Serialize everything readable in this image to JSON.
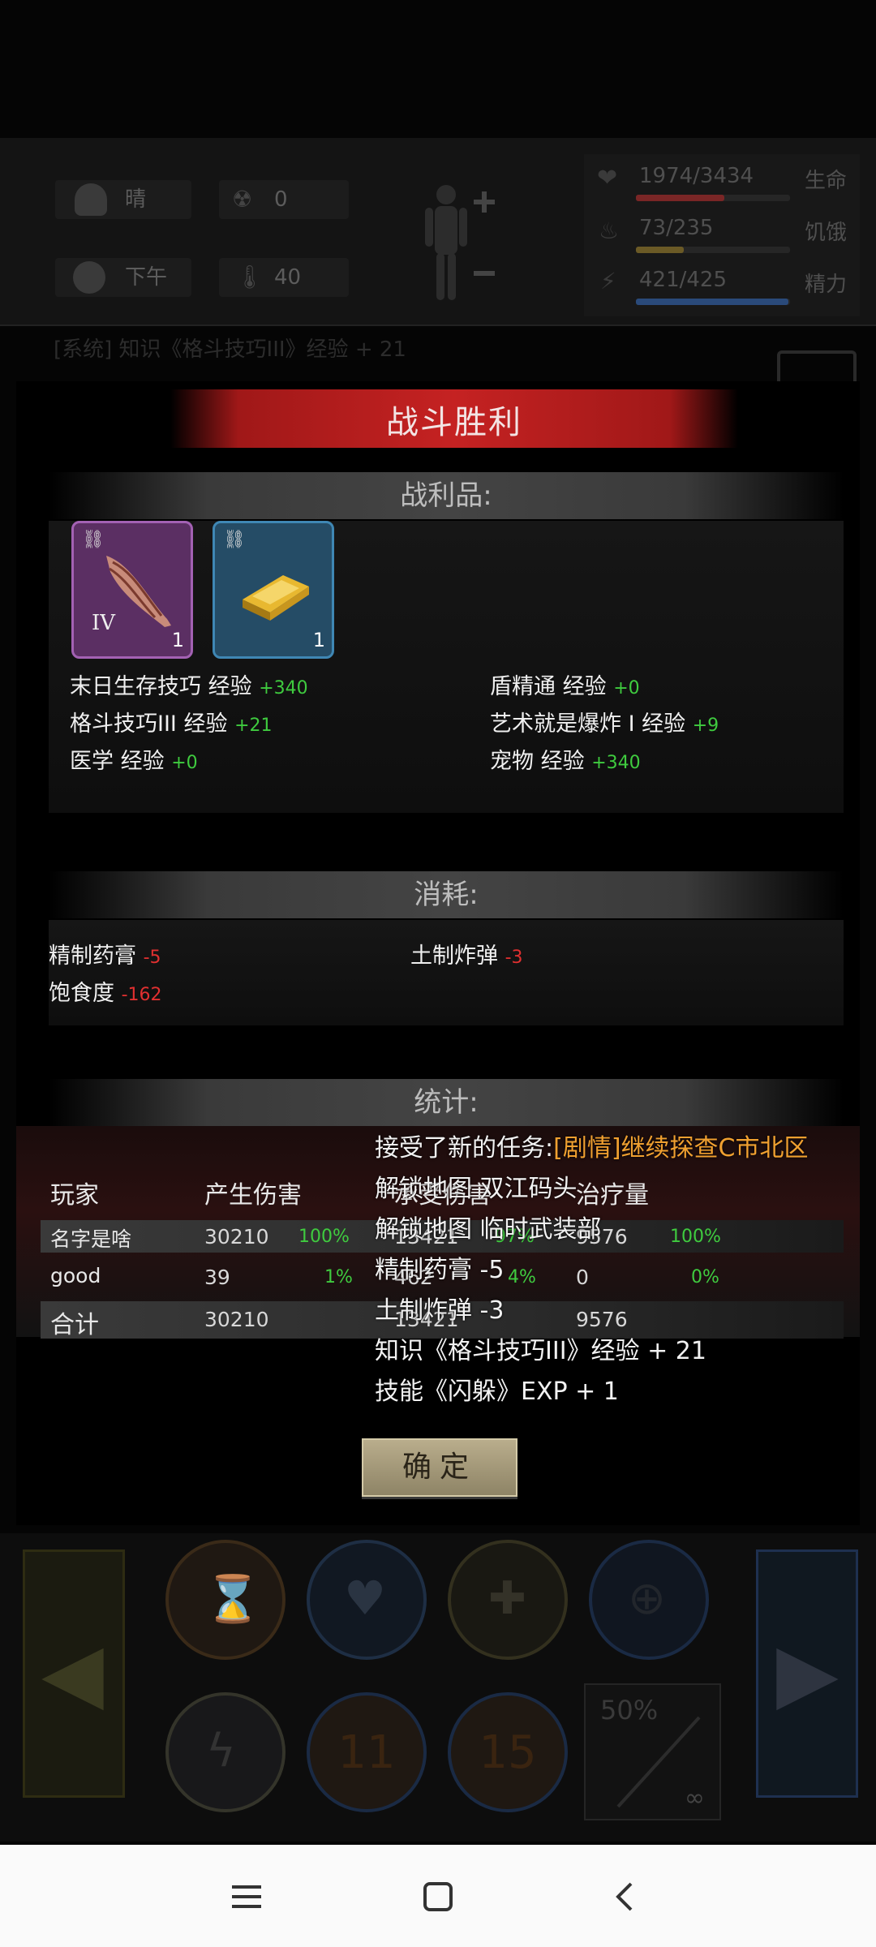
{
  "hud": {
    "weather": "晴",
    "radiation": "0",
    "time_of_day": "下午",
    "temperature": "40",
    "health": {
      "value": "1974/3434",
      "label": "生命",
      "fraction": 0.575,
      "color": "#7a2626"
    },
    "hunger": {
      "value": "73/235",
      "label": "饥饿",
      "fraction": 0.31,
      "color": "#6b5a26"
    },
    "energy": {
      "value": "421/425",
      "label": "精力",
      "fraction": 0.99,
      "color": "#2a4a7a"
    },
    "log_line": "[系统] 知识《格斗技巧III》经验 + 21"
  },
  "dialog": {
    "title": "战斗胜利",
    "loot": {
      "header": "战利品:",
      "items": [
        {
          "icon": "meat-icon",
          "qty": "1",
          "tier": "IV"
        },
        {
          "icon": "gold-bar-icon",
          "qty": "1"
        }
      ],
      "exp_left": [
        {
          "name": "末日生存技巧 经验",
          "delta": "+340"
        },
        {
          "name": "格斗技巧III 经验",
          "delta": "+21"
        },
        {
          "name": "医学 经验",
          "delta": "+0"
        }
      ],
      "exp_right": [
        {
          "name": "盾精通 经验",
          "delta": "+0"
        },
        {
          "name": "艺术就是爆炸 I 经验",
          "delta": "+9"
        },
        {
          "name": "宠物 经验",
          "delta": "+340"
        }
      ]
    },
    "consume": {
      "header": "消耗:",
      "items": [
        {
          "name": "精制药膏",
          "delta": "-5"
        },
        {
          "name": "土制炸弹",
          "delta": "-3"
        },
        {
          "name": "饱食度",
          "delta": "-162"
        }
      ]
    },
    "stats": {
      "header": "统计:",
      "columns": [
        "玩家",
        "产生伤害",
        "承受伤害",
        "治疗量"
      ],
      "rows": [
        {
          "player": "名字是啥",
          "damage": "30210",
          "damage_pct": "100%",
          "taken": "13421",
          "taken_pct": "97%",
          "heal": "9576",
          "heal_pct": "100%"
        },
        {
          "player": "good",
          "damage": "39",
          "damage_pct": "1%",
          "taken": "462",
          "taken_pct": "4%",
          "heal": "0",
          "heal_pct": "0%"
        }
      ],
      "total": {
        "label": "合计",
        "damage": "30210",
        "taken": "13421",
        "heal": "9576"
      }
    },
    "notifications": {
      "quest_prefix": "接受了新的任务:",
      "quest_name": "[剧情]继续探查C市北区",
      "lines": [
        "解锁地图 双江码头",
        "解锁地图 临时武装部",
        "精制药膏 -5",
        "土制炸弹 -3",
        "知识《格斗技巧III》经验 + 21",
        "技能《闪躲》EXP + 1"
      ]
    },
    "confirm_label": "确定"
  },
  "controls": {
    "buff1": "11",
    "buff2": "15",
    "weapon_durability": "50%",
    "ammo": "∞"
  }
}
